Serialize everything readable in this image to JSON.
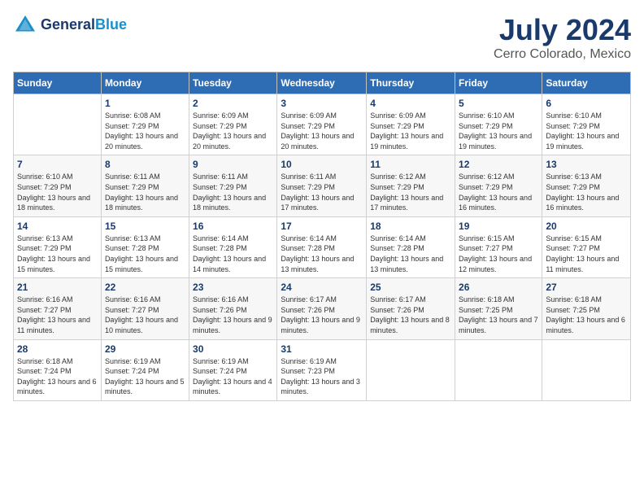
{
  "logo": {
    "line1": "General",
    "line2": "Blue"
  },
  "title": "July 2024",
  "location": "Cerro Colorado, Mexico",
  "days_header": [
    "Sunday",
    "Monday",
    "Tuesday",
    "Wednesday",
    "Thursday",
    "Friday",
    "Saturday"
  ],
  "weeks": [
    [
      {
        "num": "",
        "sunrise": "",
        "sunset": "",
        "daylight": ""
      },
      {
        "num": "1",
        "sunrise": "Sunrise: 6:08 AM",
        "sunset": "Sunset: 7:29 PM",
        "daylight": "Daylight: 13 hours and 20 minutes."
      },
      {
        "num": "2",
        "sunrise": "Sunrise: 6:09 AM",
        "sunset": "Sunset: 7:29 PM",
        "daylight": "Daylight: 13 hours and 20 minutes."
      },
      {
        "num": "3",
        "sunrise": "Sunrise: 6:09 AM",
        "sunset": "Sunset: 7:29 PM",
        "daylight": "Daylight: 13 hours and 20 minutes."
      },
      {
        "num": "4",
        "sunrise": "Sunrise: 6:09 AM",
        "sunset": "Sunset: 7:29 PM",
        "daylight": "Daylight: 13 hours and 19 minutes."
      },
      {
        "num": "5",
        "sunrise": "Sunrise: 6:10 AM",
        "sunset": "Sunset: 7:29 PM",
        "daylight": "Daylight: 13 hours and 19 minutes."
      },
      {
        "num": "6",
        "sunrise": "Sunrise: 6:10 AM",
        "sunset": "Sunset: 7:29 PM",
        "daylight": "Daylight: 13 hours and 19 minutes."
      }
    ],
    [
      {
        "num": "7",
        "sunrise": "Sunrise: 6:10 AM",
        "sunset": "Sunset: 7:29 PM",
        "daylight": "Daylight: 13 hours and 18 minutes."
      },
      {
        "num": "8",
        "sunrise": "Sunrise: 6:11 AM",
        "sunset": "Sunset: 7:29 PM",
        "daylight": "Daylight: 13 hours and 18 minutes."
      },
      {
        "num": "9",
        "sunrise": "Sunrise: 6:11 AM",
        "sunset": "Sunset: 7:29 PM",
        "daylight": "Daylight: 13 hours and 18 minutes."
      },
      {
        "num": "10",
        "sunrise": "Sunrise: 6:11 AM",
        "sunset": "Sunset: 7:29 PM",
        "daylight": "Daylight: 13 hours and 17 minutes."
      },
      {
        "num": "11",
        "sunrise": "Sunrise: 6:12 AM",
        "sunset": "Sunset: 7:29 PM",
        "daylight": "Daylight: 13 hours and 17 minutes."
      },
      {
        "num": "12",
        "sunrise": "Sunrise: 6:12 AM",
        "sunset": "Sunset: 7:29 PM",
        "daylight": "Daylight: 13 hours and 16 minutes."
      },
      {
        "num": "13",
        "sunrise": "Sunrise: 6:13 AM",
        "sunset": "Sunset: 7:29 PM",
        "daylight": "Daylight: 13 hours and 16 minutes."
      }
    ],
    [
      {
        "num": "14",
        "sunrise": "Sunrise: 6:13 AM",
        "sunset": "Sunset: 7:29 PM",
        "daylight": "Daylight: 13 hours and 15 minutes."
      },
      {
        "num": "15",
        "sunrise": "Sunrise: 6:13 AM",
        "sunset": "Sunset: 7:28 PM",
        "daylight": "Daylight: 13 hours and 15 minutes."
      },
      {
        "num": "16",
        "sunrise": "Sunrise: 6:14 AM",
        "sunset": "Sunset: 7:28 PM",
        "daylight": "Daylight: 13 hours and 14 minutes."
      },
      {
        "num": "17",
        "sunrise": "Sunrise: 6:14 AM",
        "sunset": "Sunset: 7:28 PM",
        "daylight": "Daylight: 13 hours and 13 minutes."
      },
      {
        "num": "18",
        "sunrise": "Sunrise: 6:14 AM",
        "sunset": "Sunset: 7:28 PM",
        "daylight": "Daylight: 13 hours and 13 minutes."
      },
      {
        "num": "19",
        "sunrise": "Sunrise: 6:15 AM",
        "sunset": "Sunset: 7:27 PM",
        "daylight": "Daylight: 13 hours and 12 minutes."
      },
      {
        "num": "20",
        "sunrise": "Sunrise: 6:15 AM",
        "sunset": "Sunset: 7:27 PM",
        "daylight": "Daylight: 13 hours and 11 minutes."
      }
    ],
    [
      {
        "num": "21",
        "sunrise": "Sunrise: 6:16 AM",
        "sunset": "Sunset: 7:27 PM",
        "daylight": "Daylight: 13 hours and 11 minutes."
      },
      {
        "num": "22",
        "sunrise": "Sunrise: 6:16 AM",
        "sunset": "Sunset: 7:27 PM",
        "daylight": "Daylight: 13 hours and 10 minutes."
      },
      {
        "num": "23",
        "sunrise": "Sunrise: 6:16 AM",
        "sunset": "Sunset: 7:26 PM",
        "daylight": "Daylight: 13 hours and 9 minutes."
      },
      {
        "num": "24",
        "sunrise": "Sunrise: 6:17 AM",
        "sunset": "Sunset: 7:26 PM",
        "daylight": "Daylight: 13 hours and 9 minutes."
      },
      {
        "num": "25",
        "sunrise": "Sunrise: 6:17 AM",
        "sunset": "Sunset: 7:26 PM",
        "daylight": "Daylight: 13 hours and 8 minutes."
      },
      {
        "num": "26",
        "sunrise": "Sunrise: 6:18 AM",
        "sunset": "Sunset: 7:25 PM",
        "daylight": "Daylight: 13 hours and 7 minutes."
      },
      {
        "num": "27",
        "sunrise": "Sunrise: 6:18 AM",
        "sunset": "Sunset: 7:25 PM",
        "daylight": "Daylight: 13 hours and 6 minutes."
      }
    ],
    [
      {
        "num": "28",
        "sunrise": "Sunrise: 6:18 AM",
        "sunset": "Sunset: 7:24 PM",
        "daylight": "Daylight: 13 hours and 6 minutes."
      },
      {
        "num": "29",
        "sunrise": "Sunrise: 6:19 AM",
        "sunset": "Sunset: 7:24 PM",
        "daylight": "Daylight: 13 hours and 5 minutes."
      },
      {
        "num": "30",
        "sunrise": "Sunrise: 6:19 AM",
        "sunset": "Sunset: 7:24 PM",
        "daylight": "Daylight: 13 hours and 4 minutes."
      },
      {
        "num": "31",
        "sunrise": "Sunrise: 6:19 AM",
        "sunset": "Sunset: 7:23 PM",
        "daylight": "Daylight: 13 hours and 3 minutes."
      },
      {
        "num": "",
        "sunrise": "",
        "sunset": "",
        "daylight": ""
      },
      {
        "num": "",
        "sunrise": "",
        "sunset": "",
        "daylight": ""
      },
      {
        "num": "",
        "sunrise": "",
        "sunset": "",
        "daylight": ""
      }
    ]
  ]
}
